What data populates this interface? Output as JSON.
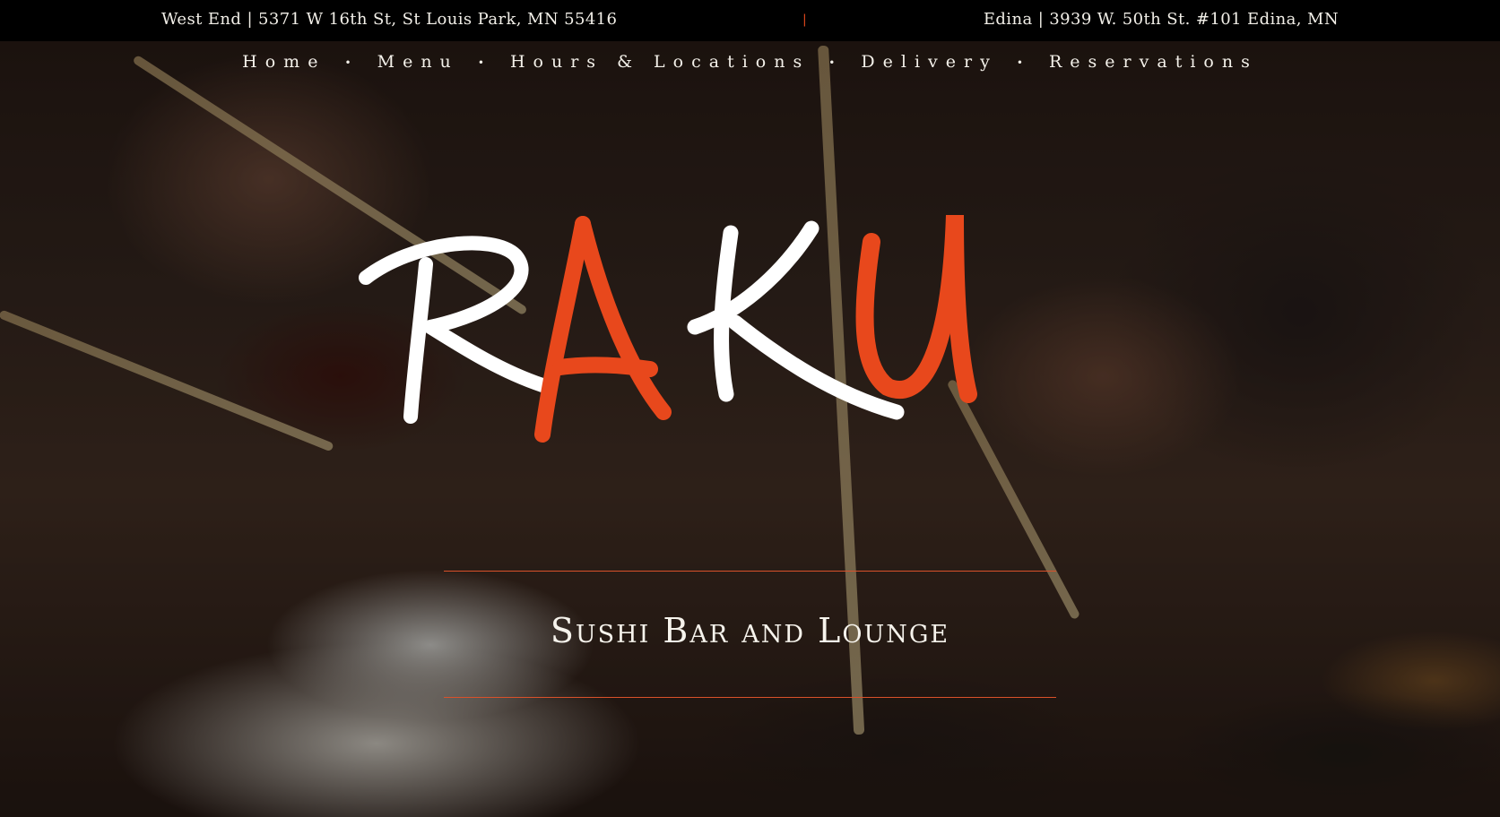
{
  "topbar": {
    "left_address": "West End | 5371 W 16th St, St Louis Park, MN 55416",
    "divider": "|",
    "right_address": "Edina | 3939 W. 50th St. #101 Edina, MN"
  },
  "nav": {
    "items": [
      {
        "label": "Home"
      },
      {
        "label": "Menu"
      },
      {
        "label": "Hours & Locations"
      },
      {
        "label": "Delivery"
      },
      {
        "label": "Reservations"
      }
    ],
    "separator": "•"
  },
  "logo": {
    "letters": [
      "R",
      "A",
      "K",
      "U"
    ],
    "colors": {
      "white": "#ffffff",
      "accent": "#e8481c"
    }
  },
  "tagline": "Sushi Bar and Lounge",
  "colors": {
    "topbar_bg": "#000000",
    "accent": "#e8481c",
    "rule": "#d9512a",
    "text": "#f4f1ea"
  }
}
